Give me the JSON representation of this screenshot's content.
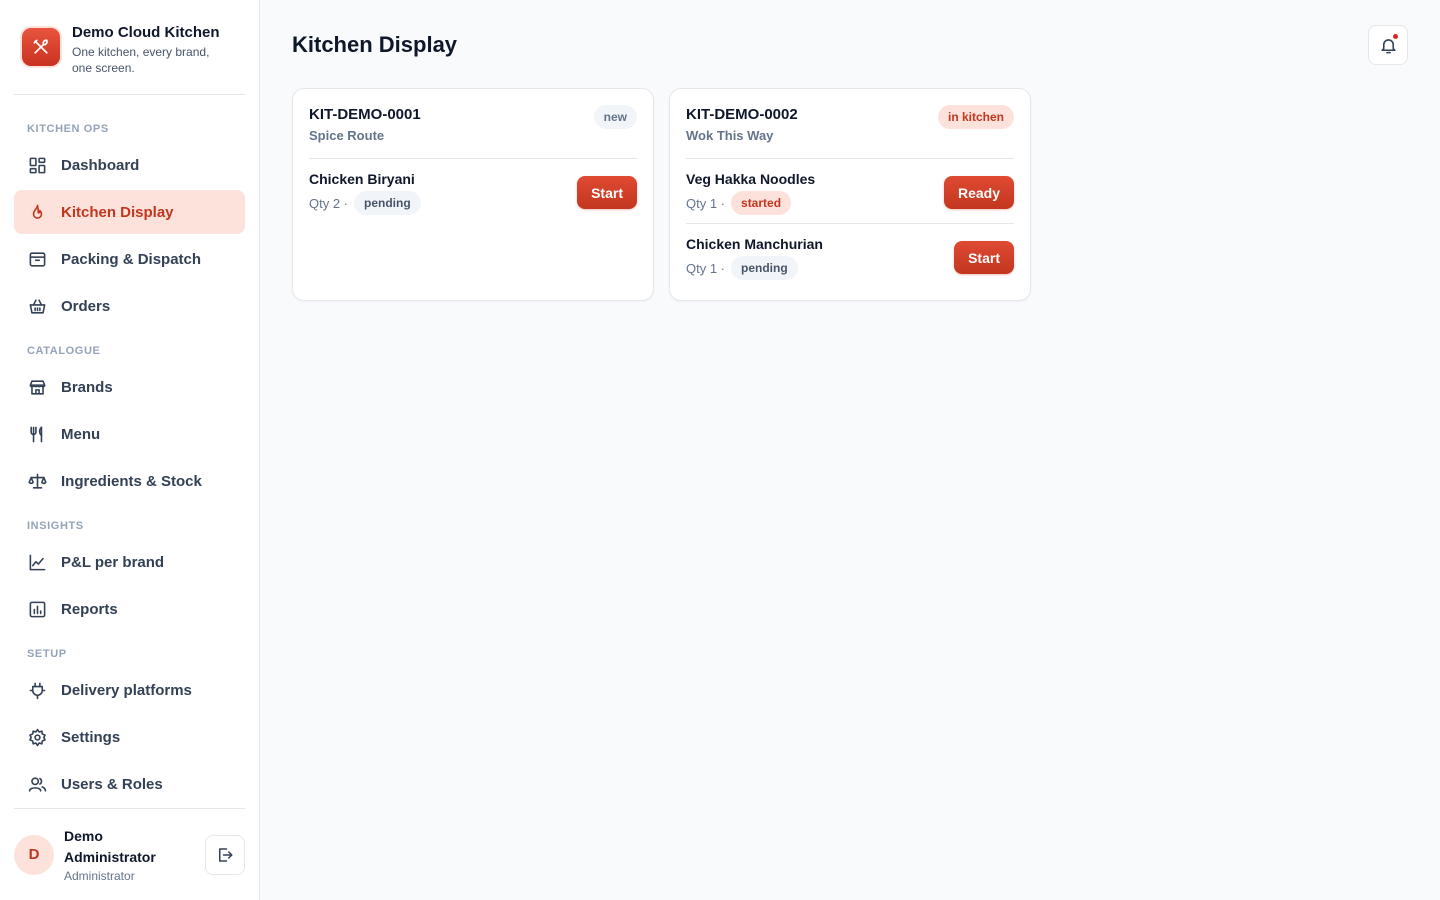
{
  "app": {
    "name": "Demo Cloud Kitchen",
    "tagline": "One kitchen, every brand, one screen."
  },
  "colors": {
    "accent": "#c2361f",
    "accent_light": "#fde2dc",
    "sidebar_bg": "#ffffff",
    "page_bg": "#f8fafc"
  },
  "sidebar": {
    "sections": [
      {
        "title": "KITCHEN OPS",
        "items": [
          {
            "label": "Dashboard",
            "icon": "dashboard-icon"
          },
          {
            "label": "Kitchen Display",
            "icon": "flame-icon",
            "active": true
          },
          {
            "label": "Packing & Dispatch",
            "icon": "archive-box-icon"
          },
          {
            "label": "Orders",
            "icon": "basket-icon"
          }
        ]
      },
      {
        "title": "CATALOGUE",
        "items": [
          {
            "label": "Brands",
            "icon": "store-icon"
          },
          {
            "label": "Menu",
            "icon": "utensils-icon"
          },
          {
            "label": "Ingredients & Stock",
            "icon": "scale-icon"
          }
        ]
      },
      {
        "title": "INSIGHTS",
        "items": [
          {
            "label": "P&L per brand",
            "icon": "line-chart-icon"
          },
          {
            "label": "Reports",
            "icon": "bar-chart-icon"
          }
        ]
      },
      {
        "title": "SETUP",
        "items": [
          {
            "label": "Delivery platforms",
            "icon": "plug-icon"
          },
          {
            "label": "Settings",
            "icon": "gear-icon"
          },
          {
            "label": "Users & Roles",
            "icon": "users-icon"
          }
        ]
      }
    ]
  },
  "user": {
    "initial": "D",
    "name": "Demo Administrator",
    "role": "Administrator"
  },
  "page": {
    "title": "Kitchen Display"
  },
  "orders": [
    {
      "id": "KIT-DEMO-0001",
      "brand": "Spice Route",
      "status": "new",
      "status_kind": "new",
      "items": [
        {
          "name": "Chicken Biryani",
          "qty": "Qty 2 ·",
          "state": "pending",
          "action": "Start"
        }
      ]
    },
    {
      "id": "KIT-DEMO-0002",
      "brand": "Wok This Way",
      "status": "in kitchen",
      "status_kind": "kitchen",
      "items": [
        {
          "name": "Veg Hakka Noodles",
          "qty": "Qty 1 ·",
          "state": "started",
          "action": "Ready"
        },
        {
          "name": "Chicken Manchurian",
          "qty": "Qty 1 ·",
          "state": "pending",
          "action": "Start"
        }
      ]
    }
  ]
}
